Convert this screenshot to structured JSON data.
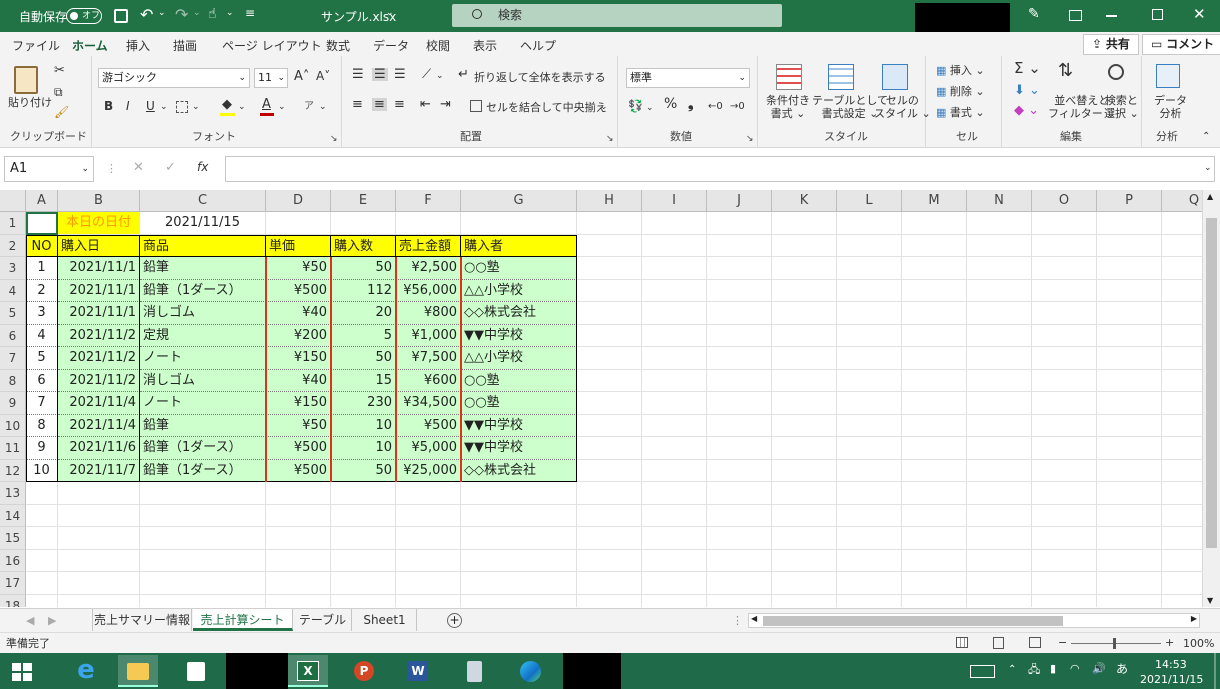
{
  "titlebar": {
    "autosave_label": "自動保存",
    "autosave_state": "オフ",
    "file_name": "サンプル.xlsx",
    "search_placeholder": "検索"
  },
  "menu": {
    "items": [
      "ファイル",
      "ホーム",
      "挿入",
      "描画",
      "ページ レイアウト",
      "数式",
      "データ",
      "校閲",
      "表示",
      "ヘルプ"
    ],
    "active": "ホーム",
    "share_label": "共有",
    "comment_label": "コメント"
  },
  "ribbon": {
    "clipboard": {
      "paste": "貼り付け",
      "group": "クリップボード"
    },
    "font": {
      "name": "游ゴシック",
      "size": "11",
      "group": "フォント",
      "bold": "B",
      "italic": "I",
      "underline": "U"
    },
    "alignment": {
      "wrap": "折り返して全体を表示する",
      "merge": "セルを結合して中央揃え",
      "group": "配置"
    },
    "number": {
      "format": "標準",
      "group": "数値"
    },
    "styles": {
      "conditional": [
        "条件付き",
        "書式"
      ],
      "table": [
        "テーブルとして",
        "書式設定"
      ],
      "cell": [
        "セルの",
        "スタイル"
      ],
      "group": "スタイル"
    },
    "cells": {
      "insert": "挿入",
      "delete": "削除",
      "format": "書式",
      "group": "セル"
    },
    "editing": {
      "sort": [
        "並べ替えと",
        "フィルター"
      ],
      "find": [
        "検索と",
        "選択"
      ],
      "group": "編集"
    },
    "analysis": {
      "data": [
        "データ",
        "分析"
      ],
      "group": "分析"
    }
  },
  "formula_bar": {
    "name_box": "A1",
    "formula": ""
  },
  "columns": [
    "A",
    "B",
    "C",
    "D",
    "E",
    "F",
    "G",
    "H",
    "I",
    "J",
    "K",
    "L",
    "M",
    "N",
    "O",
    "P",
    "Q"
  ],
  "rows": [
    "1",
    "2",
    "3",
    "4",
    "5",
    "6",
    "7",
    "8",
    "9",
    "10",
    "11",
    "12",
    "13",
    "14",
    "15",
    "16",
    "17",
    "18"
  ],
  "sheet": {
    "today_label": "本日の日付",
    "today_value": "2021/11/15",
    "headers": [
      "NO",
      "購入日",
      "商品",
      "単価",
      "購入数",
      "売上金額",
      "購入者"
    ],
    "data": [
      [
        "1",
        "2021/11/1",
        "鉛筆",
        "¥50",
        "50",
        "¥2,500",
        "○○塾"
      ],
      [
        "2",
        "2021/11/1",
        "鉛筆（1ダース）",
        "¥500",
        "112",
        "¥56,000",
        "△△小学校"
      ],
      [
        "3",
        "2021/11/1",
        "消しゴム",
        "¥40",
        "20",
        "¥800",
        "◇◇株式会社"
      ],
      [
        "4",
        "2021/11/2",
        "定規",
        "¥200",
        "5",
        "¥1,000",
        "▼▼中学校"
      ],
      [
        "5",
        "2021/11/2",
        "ノート",
        "¥150",
        "50",
        "¥7,500",
        "△△小学校"
      ],
      [
        "6",
        "2021/11/2",
        "消しゴム",
        "¥40",
        "15",
        "¥600",
        "○○塾"
      ],
      [
        "7",
        "2021/11/4",
        "ノート",
        "¥150",
        "230",
        "¥34,500",
        "○○塾"
      ],
      [
        "8",
        "2021/11/4",
        "鉛筆",
        "¥50",
        "10",
        "¥500",
        "▼▼中学校"
      ],
      [
        "9",
        "2021/11/6",
        "鉛筆（1ダース）",
        "¥500",
        "10",
        "¥5,000",
        "▼▼中学校"
      ],
      [
        "10",
        "2021/11/7",
        "鉛筆（1ダース）",
        "¥500",
        "50",
        "¥25,000",
        "◇◇株式会社"
      ]
    ]
  },
  "sheet_tabs": [
    "売上サマリー情報",
    "売上計算シート",
    "テーブル",
    "Sheet1"
  ],
  "active_tab": "売上計算シート",
  "status": {
    "ready": "準備完了",
    "zoom": "100%"
  },
  "taskbar": {
    "time": "14:53",
    "date": "2021/11/15",
    "ime": "あ"
  },
  "colors": {
    "excel_green": "#217346",
    "highlight_yellow": "#ffff00",
    "data_green": "#ccffcc",
    "red_border": "#e0301e",
    "label_orange": "#ff9900"
  }
}
